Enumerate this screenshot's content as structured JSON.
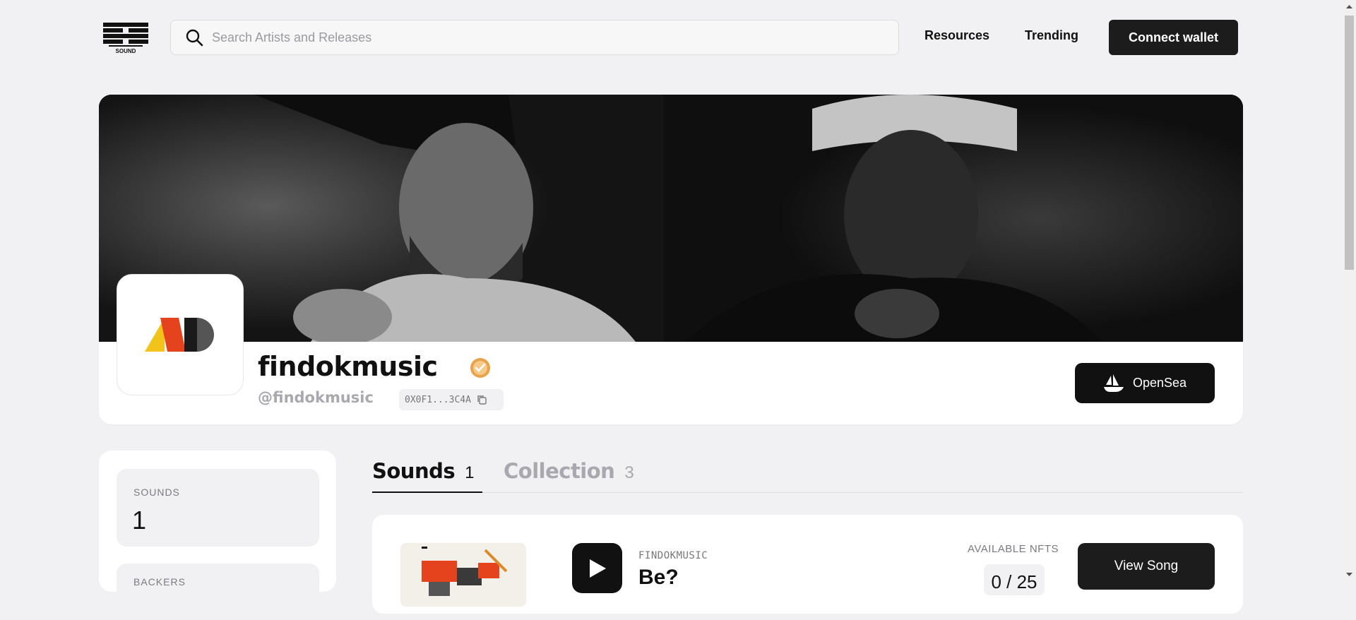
{
  "header": {
    "logo_text": "SOUND",
    "search_placeholder": "Search Artists and Releases",
    "nav": {
      "resources": "Resources",
      "trending": "Trending"
    },
    "connect_wallet": "Connect wallet"
  },
  "profile": {
    "name": "findokmusic",
    "handle": "@findokmusic",
    "wallet": "0X0F1...3C4A",
    "opensea_label": "OpenSea",
    "verified": true
  },
  "stats": {
    "sounds": {
      "label": "SOUNDS",
      "value": "1"
    },
    "backers": {
      "label": "BACKERS"
    }
  },
  "tabs": [
    {
      "label": "Sounds",
      "count": "1",
      "active": true
    },
    {
      "label": "Collection",
      "count": "3",
      "active": false
    }
  ],
  "song": {
    "artist": "FINDOKMUSIC",
    "title": "Be?",
    "available_label": "AVAILABLE NFTS",
    "available": "0 / 25",
    "view_label": "View Song"
  },
  "colors": {
    "page_bg": "#f1f1f3",
    "button_dark": "#1c1c1c",
    "muted_text": "#a8a8ae",
    "verified_orange": "#e8a24a"
  }
}
